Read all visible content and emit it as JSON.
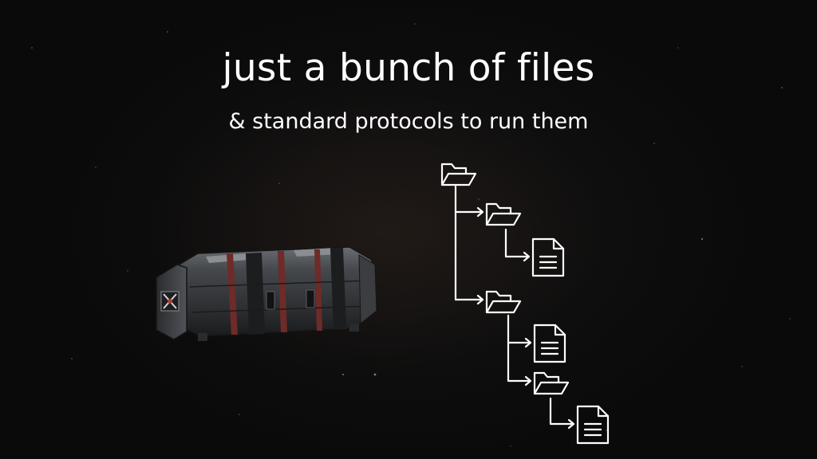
{
  "slide": {
    "title": "just a bunch of files",
    "subtitle": "& standard protocols to run them"
  },
  "illustration": {
    "capsule": "cargo-container",
    "tree": [
      "folder-icon",
      "folder-icon",
      "file-icon",
      "folder-icon",
      "file-icon",
      "folder-icon",
      "file-icon"
    ]
  },
  "colors": {
    "background": "#0b0b0b",
    "text": "#ffffff",
    "capsule_body": "#3a3c3f",
    "capsule_stripe": "#6e2b27"
  }
}
